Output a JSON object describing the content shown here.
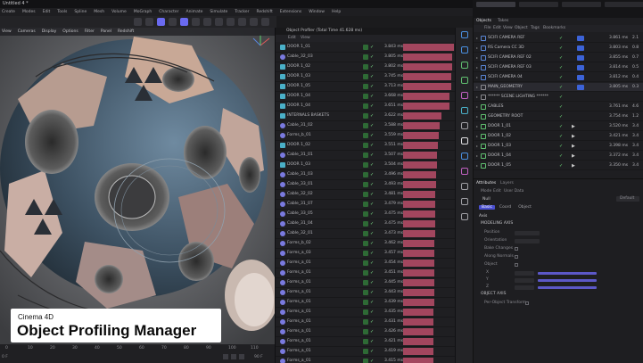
{
  "app": {
    "title": "Untitled 4 *",
    "top_tabs": [
      "Startup",
      "Model",
      "Script",
      "Nodes",
      "Animate"
    ]
  },
  "menu": [
    "Create",
    "Modes",
    "Edit",
    "Tools",
    "Spline",
    "Mesh",
    "Volume",
    "MoGraph",
    "Character",
    "Animate",
    "Simulate",
    "Tracker",
    "Redshift",
    "Extensions",
    "Window",
    "Help"
  ],
  "viewport": {
    "menu": [
      "View",
      "Cameras",
      "Display",
      "Options",
      "Filter",
      "Panel",
      "Redshift"
    ],
    "timeline_ticks": [
      "0",
      "10",
      "20",
      "30",
      "40",
      "50",
      "60",
      "70",
      "80",
      "90",
      "100",
      "110"
    ],
    "frame_left": "0 F",
    "frame_right": "90 F"
  },
  "caption": {
    "subtitle": "Cinema 4D",
    "title": "Object Profiling Manager"
  },
  "profiler": {
    "title": "Object Profiler (Total Time 41.628 ms)",
    "menu": [
      "Edit",
      "View"
    ],
    "rows": [
      {
        "name": "DOOR 1_01",
        "ms": "3.843 ms",
        "pct": 1.0,
        "icon": "poly"
      },
      {
        "name": "Cable_32_03",
        "ms": "3.805 ms",
        "pct": 0.97,
        "icon": "spline"
      },
      {
        "name": "DOOR 1_02",
        "ms": "3.802 ms",
        "pct": 0.97,
        "icon": "poly"
      },
      {
        "name": "DOOR 1_03",
        "ms": "3.745 ms",
        "pct": 0.95,
        "icon": "poly"
      },
      {
        "name": "DOOR 1_05",
        "ms": "3.713 ms",
        "pct": 0.94,
        "icon": "poly"
      },
      {
        "name": "DOOR 1_04",
        "ms": "3.668 ms",
        "pct": 0.92,
        "icon": "poly"
      },
      {
        "name": "DOOR 1_04",
        "ms": "3.651 ms",
        "pct": 0.91,
        "icon": "poly"
      },
      {
        "name": "INTERNALS BASKETS",
        "ms": "3.622 ms",
        "pct": 0.76,
        "icon": "poly"
      },
      {
        "name": "Cable_31_02",
        "ms": "3.588 ms",
        "pct": 0.72,
        "icon": "spline"
      },
      {
        "name": "Forms_b_01",
        "ms": "3.559 ms",
        "pct": 0.7,
        "icon": "spline"
      },
      {
        "name": "DOOR 1_02",
        "ms": "3.551 ms",
        "pct": 0.68,
        "icon": "poly"
      },
      {
        "name": "Cable_31_01",
        "ms": "3.507 ms",
        "pct": 0.66,
        "icon": "spline"
      },
      {
        "name": "DOOR 1_03",
        "ms": "3.504 ms",
        "pct": 0.66,
        "icon": "poly"
      },
      {
        "name": "Cable_31_03",
        "ms": "3.496 ms",
        "pct": 0.65,
        "icon": "spline"
      },
      {
        "name": "Cable_33_01",
        "ms": "3.493 ms",
        "pct": 0.65,
        "icon": "spline"
      },
      {
        "name": "Cable_32_02",
        "ms": "3.481 ms",
        "pct": 0.64,
        "icon": "spline"
      },
      {
        "name": "Cable_31_07",
        "ms": "3.479 ms",
        "pct": 0.64,
        "icon": "spline"
      },
      {
        "name": "Cable_33_05",
        "ms": "3.475 ms",
        "pct": 0.63,
        "icon": "spline"
      },
      {
        "name": "Cable_31_04",
        "ms": "3.475 ms",
        "pct": 0.63,
        "icon": "spline"
      },
      {
        "name": "Cable_32_01",
        "ms": "3.473 ms",
        "pct": 0.63,
        "icon": "spline"
      },
      {
        "name": "Forms_b_02",
        "ms": "3.462 ms",
        "pct": 0.62,
        "icon": "spline"
      },
      {
        "name": "Forms_a_03",
        "ms": "3.457 ms",
        "pct": 0.62,
        "icon": "spline"
      },
      {
        "name": "Forms_a_01",
        "ms": "3.454 ms",
        "pct": 0.62,
        "icon": "spline"
      },
      {
        "name": "Forms_a_01",
        "ms": "3.451 ms",
        "pct": 0.62,
        "icon": "spline"
      },
      {
        "name": "Forms_a_01",
        "ms": "3.445 ms",
        "pct": 0.61,
        "icon": "spline"
      },
      {
        "name": "Forms_a_01",
        "ms": "3.443 ms",
        "pct": 0.61,
        "icon": "spline"
      },
      {
        "name": "Forms_a_01",
        "ms": "3.439 ms",
        "pct": 0.61,
        "icon": "spline"
      },
      {
        "name": "Forms_a_01",
        "ms": "3.435 ms",
        "pct": 0.6,
        "icon": "spline"
      },
      {
        "name": "Forms_a_01",
        "ms": "3.431 ms",
        "pct": 0.6,
        "icon": "spline"
      },
      {
        "name": "Forms_a_01",
        "ms": "3.426 ms",
        "pct": 0.6,
        "icon": "spline"
      },
      {
        "name": "Forms_a_01",
        "ms": "3.421 ms",
        "pct": 0.59,
        "icon": "spline"
      },
      {
        "name": "Forms_a_01",
        "ms": "3.419 ms",
        "pct": 0.59,
        "icon": "spline"
      },
      {
        "name": "Forms_a_01",
        "ms": "3.415 ms",
        "pct": 0.59,
        "icon": "spline"
      }
    ]
  },
  "objects": {
    "tabs": [
      "Objects",
      "Takes"
    ],
    "menu": [
      "File",
      "Edit",
      "View",
      "Object",
      "Tags",
      "Bookmarks"
    ],
    "rows": [
      {
        "name": "SCIFI CAMERA REF",
        "value": "3.861 ms",
        "value2": "2.1",
        "color": "#5a86d6"
      },
      {
        "name": "RS Camera CC 3D",
        "value": "3.803 ms",
        "value2": "0.8",
        "color": "#5a86d6"
      },
      {
        "name": "SCIFI CAMERA REF 02",
        "value": "3.855 ms",
        "value2": "0.7",
        "color": "#5a86d6"
      },
      {
        "name": "SCIFI CAMERA REF 03",
        "value": "3.814 ms",
        "value2": "0.5",
        "color": "#5a86d6"
      },
      {
        "name": "SCIFI CAMERA 04",
        "value": "3.812 ms",
        "value2": "0.4",
        "color": "#5a86d6"
      },
      {
        "name": "MAIN_GEOMETRY",
        "value": "3.805 ms",
        "value2": "0.3",
        "color": "#8a8a90"
      },
      {
        "name": "****** SCENE LIGHTING ******",
        "value": "",
        "value2": "",
        "color": "#8a8a90"
      },
      {
        "name": "CABLES",
        "value": "3.761 ms",
        "value2": "4.6",
        "color": "#60c070"
      },
      {
        "name": "GEOMETRY ROOT",
        "value": "3.754 ms",
        "value2": "1.2",
        "color": "#60c070"
      },
      {
        "name": "DOOR 1_01",
        "value": "3.520 ms",
        "value2": "3.4",
        "color": "#60c070"
      },
      {
        "name": "DOOR 1_02",
        "value": "3.421 ms",
        "value2": "3.4",
        "color": "#60c070"
      },
      {
        "name": "DOOR 1_03",
        "value": "3.398 ms",
        "value2": "3.4",
        "color": "#60c070"
      },
      {
        "name": "DOOR 1_04",
        "value": "3.372 ms",
        "value2": "3.4",
        "color": "#60c070"
      },
      {
        "name": "DOOR 1_05",
        "value": "3.350 ms",
        "value2": "3.4",
        "color": "#60c070"
      }
    ]
  },
  "attributes": {
    "tabs": [
      "Attributes",
      "Layers"
    ],
    "menu": [
      "Mode",
      "Edit",
      "User Data"
    ],
    "object": "Null",
    "subtabs": [
      "Basic",
      "Coord",
      "Object"
    ],
    "section_title": "Axis",
    "group1": "MODELING AXIS",
    "fields": [
      "Position",
      "Orientation",
      "Bake Changes",
      "Along Normals",
      "Object"
    ],
    "xyz": [
      "X",
      "Y",
      "Z"
    ],
    "group2": "OBJECT AXIS",
    "option": "Per-Object Transform",
    "default_label": "Default"
  }
}
